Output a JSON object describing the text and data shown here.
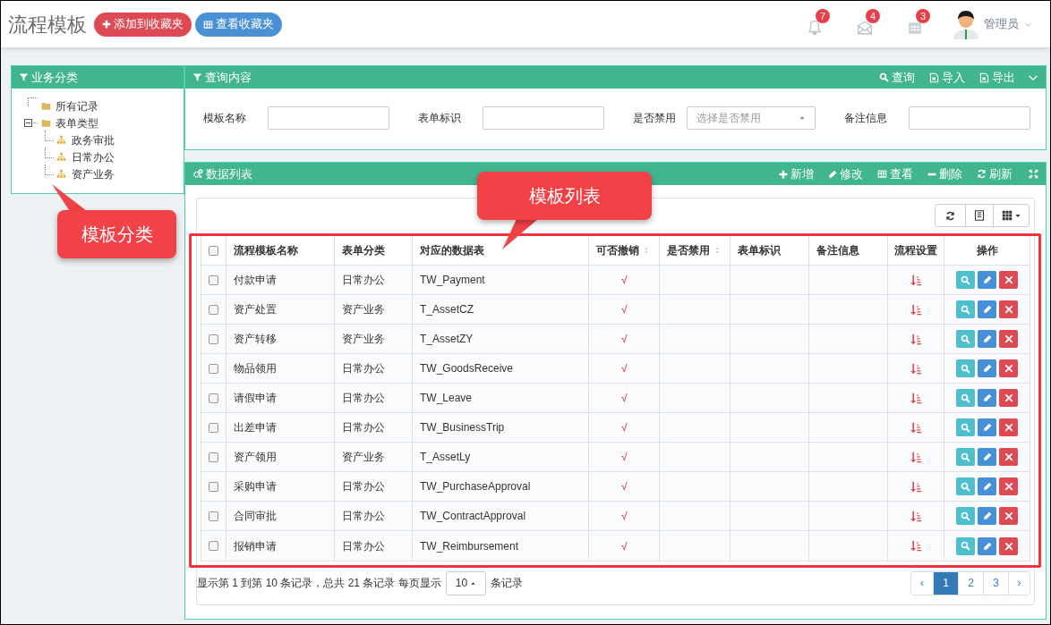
{
  "header": {
    "title": "流程模板",
    "buttons": [
      {
        "label": "添加到收藏夹",
        "kind": "add"
      },
      {
        "label": "查看收藏夹",
        "kind": "view"
      }
    ],
    "notifications": [
      {
        "kind": "bell",
        "count": "7"
      },
      {
        "kind": "mail",
        "count": "4"
      },
      {
        "kind": "calendar",
        "count": "3"
      }
    ],
    "user": {
      "name": "管理员"
    }
  },
  "category_panel": {
    "title": "业务分类",
    "tree": [
      {
        "label": "所有记录",
        "kind": "folder"
      },
      {
        "label": "表单类型",
        "kind": "folder",
        "expanded": true,
        "children": [
          {
            "label": "政务审批",
            "kind": "org"
          },
          {
            "label": "日常办公",
            "kind": "org"
          },
          {
            "label": "资产业务",
            "kind": "org"
          }
        ]
      }
    ]
  },
  "query_panel": {
    "title": "查询内容",
    "actions": [
      {
        "label": "查询",
        "kind": "search"
      },
      {
        "label": "导入",
        "kind": "import"
      },
      {
        "label": "导出",
        "kind": "export"
      }
    ],
    "fields": [
      {
        "label": "模板名称",
        "kind": "text"
      },
      {
        "label": "表单标识",
        "kind": "text"
      },
      {
        "label": "是否禁用",
        "kind": "select",
        "placeholder": "选择是否禁用"
      },
      {
        "label": "备注信息",
        "kind": "text"
      }
    ]
  },
  "data_panel": {
    "title": "数据列表",
    "actions": [
      {
        "label": "新增",
        "kind": "add"
      },
      {
        "label": "修改",
        "kind": "edit"
      },
      {
        "label": "查看",
        "kind": "view"
      },
      {
        "label": "删除",
        "kind": "delete"
      },
      {
        "label": "刷新",
        "kind": "refresh"
      }
    ],
    "table": {
      "header_checked": false,
      "columns": [
        {
          "label": "流程模板名称",
          "sortable": false
        },
        {
          "label": "表单分类",
          "sortable": false
        },
        {
          "label": "对应的数据表",
          "sortable": false
        },
        {
          "label": "可否撤销",
          "sortable": true
        },
        {
          "label": "是否禁用",
          "sortable": true
        },
        {
          "label": "表单标识",
          "sortable": false
        },
        {
          "label": "备注信息",
          "sortable": false
        },
        {
          "label": "流程设置",
          "sortable": false
        },
        {
          "label": "操作",
          "sortable": false
        }
      ],
      "rows": [
        {
          "checked": false,
          "name": "付款申请",
          "category": "日常办公",
          "table": "TW_Payment",
          "revocable": "√"
        },
        {
          "checked": false,
          "name": "资产处置",
          "category": "资产业务",
          "table": "T_AssetCZ",
          "revocable": "√"
        },
        {
          "checked": false,
          "name": "资产转移",
          "category": "资产业务",
          "table": "T_AssetZY",
          "revocable": "√"
        },
        {
          "checked": false,
          "name": "物品领用",
          "category": "日常办公",
          "table": "TW_GoodsReceive",
          "revocable": "√"
        },
        {
          "checked": false,
          "name": "请假申请",
          "category": "日常办公",
          "table": "TW_Leave",
          "revocable": "√"
        },
        {
          "checked": false,
          "name": "出差申请",
          "category": "日常办公",
          "table": "TW_BusinessTrip",
          "revocable": "√"
        },
        {
          "checked": false,
          "name": "资产领用",
          "category": "资产业务",
          "table": "T_AssetLy",
          "revocable": "√"
        },
        {
          "checked": false,
          "name": "采购申请",
          "category": "日常办公",
          "table": "TW_PurchaseApproval",
          "revocable": "√"
        },
        {
          "checked": false,
          "name": "合同审批",
          "category": "日常办公",
          "table": "TW_ContractApproval",
          "revocable": "√"
        },
        {
          "checked": false,
          "name": "报销申请",
          "category": "日常办公",
          "table": "TW_Reimbursement",
          "revocable": "√"
        }
      ]
    },
    "footer": {
      "summary": "显示第 1 到第 10 条记录，总共 21 条记录 每页显示",
      "page_size": "10",
      "suffix": "条记录"
    },
    "pagination": {
      "prev": "‹",
      "next": "›",
      "pages": [
        {
          "label": "1",
          "selected": true
        },
        {
          "label": "2",
          "selected": false
        },
        {
          "label": "3",
          "selected": false
        }
      ]
    }
  },
  "annotations": [
    {
      "text": "模板分类"
    },
    {
      "text": "模板列表"
    }
  ]
}
